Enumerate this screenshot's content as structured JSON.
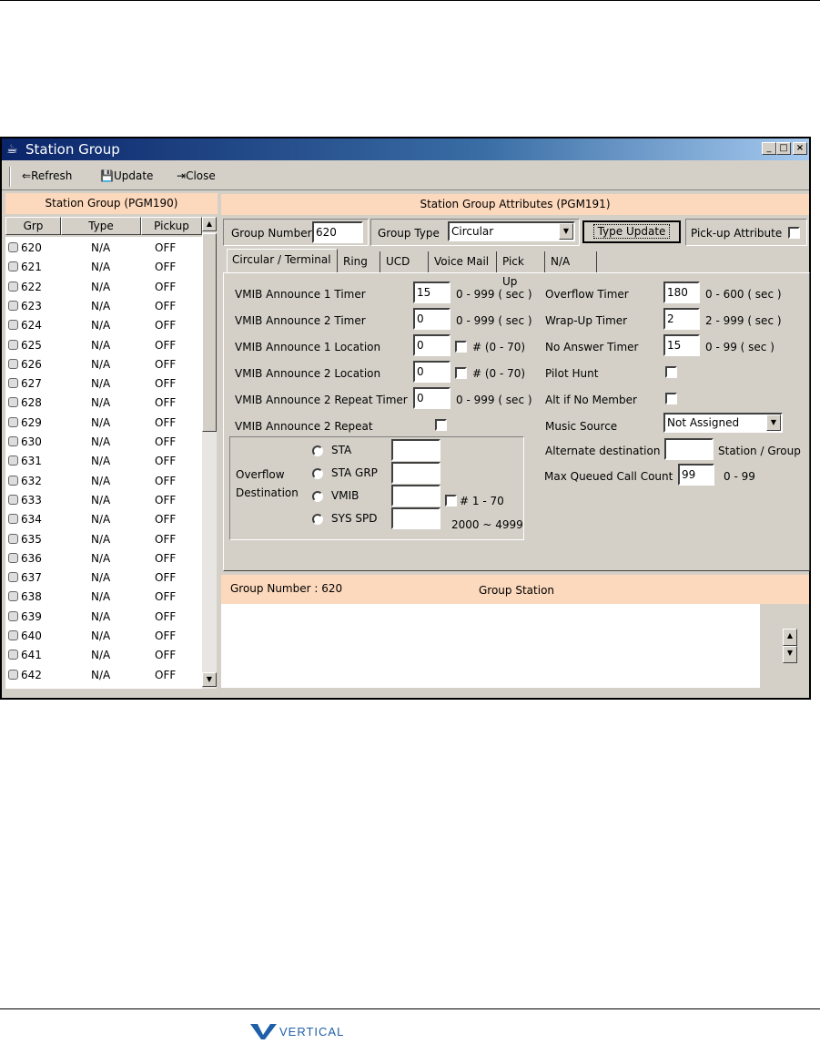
{
  "window": {
    "title": "Station Group",
    "minimize": "_",
    "maximize": "□",
    "close": "×"
  },
  "toolbar": {
    "refresh": "Refresh",
    "update": "Update",
    "close": "Close"
  },
  "left": {
    "header": "Station Group (PGM190)",
    "columns": [
      "Grp",
      "Type",
      "Pickup"
    ],
    "rows": [
      [
        "620",
        "N/A",
        "OFF"
      ],
      [
        "621",
        "N/A",
        "OFF"
      ],
      [
        "622",
        "N/A",
        "OFF"
      ],
      [
        "623",
        "N/A",
        "OFF"
      ],
      [
        "624",
        "N/A",
        "OFF"
      ],
      [
        "625",
        "N/A",
        "OFF"
      ],
      [
        "626",
        "N/A",
        "OFF"
      ],
      [
        "627",
        "N/A",
        "OFF"
      ],
      [
        "628",
        "N/A",
        "OFF"
      ],
      [
        "629",
        "N/A",
        "OFF"
      ],
      [
        "630",
        "N/A",
        "OFF"
      ],
      [
        "631",
        "N/A",
        "OFF"
      ],
      [
        "632",
        "N/A",
        "OFF"
      ],
      [
        "633",
        "N/A",
        "OFF"
      ],
      [
        "634",
        "N/A",
        "OFF"
      ],
      [
        "635",
        "N/A",
        "OFF"
      ],
      [
        "636",
        "N/A",
        "OFF"
      ],
      [
        "637",
        "N/A",
        "OFF"
      ],
      [
        "638",
        "N/A",
        "OFF"
      ],
      [
        "639",
        "N/A",
        "OFF"
      ],
      [
        "640",
        "N/A",
        "OFF"
      ],
      [
        "641",
        "N/A",
        "OFF"
      ],
      [
        "642",
        "N/A",
        "OFF"
      ]
    ]
  },
  "right": {
    "header": "Station Group Attributes (PGM191)",
    "group_number_label": "Group Number",
    "group_number": "620",
    "group_type_label": "Group Type",
    "group_type": "Circular",
    "type_update": "Type Update",
    "pickup_attr": "Pick-up Attribute",
    "tabs": [
      "Circular / Terminal",
      "Ring",
      "UCD",
      "Voice Mail",
      "Pick Up",
      "N/A"
    ],
    "active_tab": "Circular / Terminal",
    "fields": {
      "ann1_timer": {
        "label": "VMIB Announce 1 Timer",
        "value": "15",
        "range": "0 - 999 ( sec )"
      },
      "ann2_timer": {
        "label": "VMIB Announce 2 Timer",
        "value": "0",
        "range": "0 - 999 ( sec )"
      },
      "ann1_loc": {
        "label": "VMIB Announce 1 Location",
        "value": "0",
        "range": "# (0 - 70)"
      },
      "ann2_loc": {
        "label": "VMIB Announce 2 Location",
        "value": "0",
        "range": "# (0 - 70)"
      },
      "ann2_rep_timer": {
        "label": "VMIB Announce 2 Repeat Timer",
        "value": "0",
        "range": "0 - 999 ( sec )"
      },
      "ann2_repeat": {
        "label": "VMIB Announce 2 Repeat"
      },
      "overflow_timer": {
        "label": "Overflow Timer",
        "value": "180",
        "range": "0 - 600 ( sec )"
      },
      "wrapup_timer": {
        "label": "Wrap-Up Timer",
        "value": "2",
        "range": "2 - 999 ( sec )"
      },
      "noanswer_timer": {
        "label": "No Answer Timer",
        "value": "15",
        "range": "0 - 99 ( sec )"
      },
      "pilot_hunt": {
        "label": "Pilot Hunt"
      },
      "alt_no_member": {
        "label": "Alt if No Member"
      },
      "music_source": {
        "label": "Music Source",
        "value": "Not Assigned"
      },
      "alt_dest": {
        "label": "Alternate destination",
        "value": "",
        "unit": "Station / Group"
      },
      "max_queued": {
        "label": "Max Queued Call Count",
        "value": "99",
        "range": "0 - 99"
      }
    },
    "overflow": {
      "label1": "Overflow",
      "label2": "Destination",
      "options": [
        "STA",
        "STA GRP",
        "VMIB",
        "SYS SPD"
      ],
      "vmib_range": "# 1 - 70",
      "sysspd_range": "2000 ~ 4999"
    },
    "bottom": {
      "group_number": "Group Number : 620",
      "title": "Group Station"
    }
  },
  "footer": {
    "logo": "VERTICAL"
  }
}
